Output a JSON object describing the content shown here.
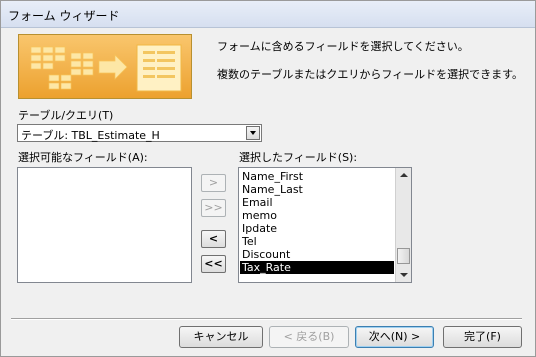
{
  "window": {
    "title": "フォーム ウィザード"
  },
  "intro": {
    "line1": "フォームに含めるフィールドを選択してください。",
    "line2": "複数のテーブルまたはクエリからフィールドを選択できます。"
  },
  "source": {
    "label": "テーブル/クエリ(T)",
    "selected": "テーブル: TBL_Estimate_H"
  },
  "available": {
    "label": "選択可能なフィールド(A):",
    "items": []
  },
  "selected_fields": {
    "label": "選択したフィールド(S):",
    "items": [
      "Name_First",
      "Name_Last",
      "Email",
      "memo",
      "Ipdate",
      "Tel",
      "Discount",
      "Tax_Rate"
    ],
    "selected_item": "Tax_Rate"
  },
  "move_buttons": {
    "add_one": ">",
    "add_all": ">>",
    "remove_one": "<",
    "remove_all": "<<"
  },
  "footer": {
    "cancel": "キャンセル",
    "back": "< 戻る(B)",
    "next": "次へ(N) >",
    "finish": "完了(F)"
  },
  "colors": {
    "selection": "#000000",
    "banner": "#f6ac3c",
    "dialog_bg": "#f0f0f0"
  }
}
